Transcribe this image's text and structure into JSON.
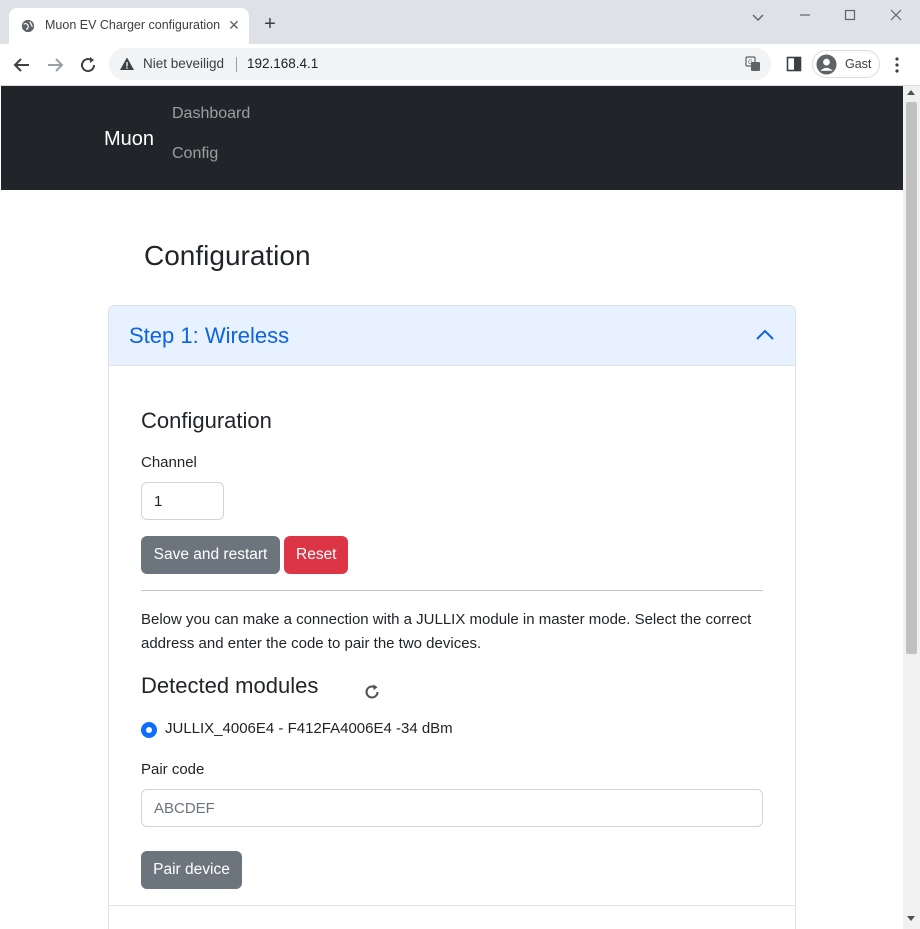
{
  "browser": {
    "tab_title": "Muon EV Charger configuration",
    "tab_close_glyph": "✕",
    "new_tab_glyph": "+",
    "security_label": "Niet beveiligd",
    "url": "192.168.4.1",
    "profile_name": "Gast",
    "icons": [
      "globe-icon",
      "close-icon",
      "plus-icon",
      "chevron-down-icon",
      "minimize-icon",
      "maximize-icon",
      "close-window-icon",
      "back-arrow-icon",
      "forward-arrow-icon",
      "reload-icon",
      "warning-icon",
      "translate-icon",
      "side-panel-icon",
      "avatar-icon",
      "kebab-menu-icon"
    ]
  },
  "navbar": {
    "brand": "Muon",
    "links": [
      {
        "label": "Dashboard"
      },
      {
        "label": "Config"
      }
    ]
  },
  "page": {
    "title": "Configuration"
  },
  "accordion": {
    "step_title": "Step 1: Wireless",
    "config_title": "Configuration",
    "channel_label": "Channel",
    "channel_value": "1",
    "save_button": "Save and restart",
    "reset_button": "Reset",
    "description": "Below you can make a connection with a JULLIX module in master mode. Select the correct address and enter the code to pair the two devices.",
    "detected_title": "Detected modules",
    "modules": [
      {
        "label": "JULLIX_4006E4 - F412FA4006E4 -34 dBm",
        "selected": true
      }
    ],
    "pair_code_label": "Pair code",
    "pair_code_value": "",
    "pair_code_placeholder": "ABCDEF",
    "pair_button": "Pair device"
  },
  "colors": {
    "navbar_bg": "#212529",
    "accordion_header_bg": "#e7f1ff",
    "accordion_title": "#0c63e4",
    "secondary": "#6c757d",
    "danger": "#dc3545",
    "primary": "#0d6efd"
  }
}
